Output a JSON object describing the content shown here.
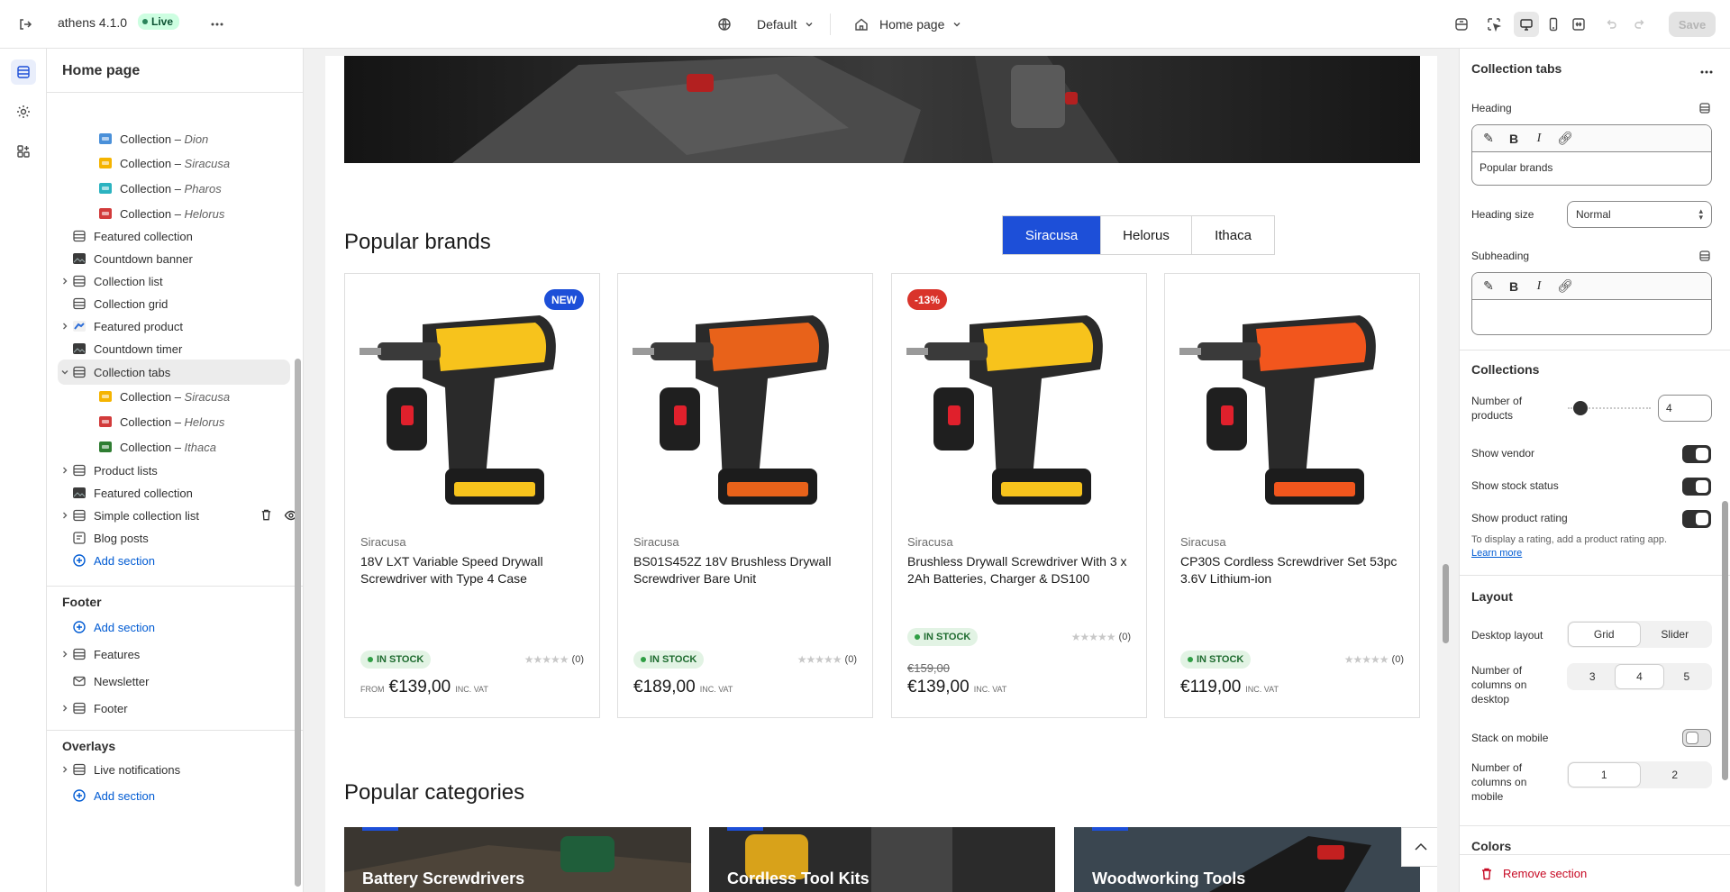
{
  "topbar": {
    "theme_name": "athens 4.1.0",
    "live_label": "Live",
    "theme_selector": "Default",
    "page_selector": "Home page",
    "save_label": "Save"
  },
  "left_panel": {
    "title": "Home page",
    "template_items": [
      {
        "label": "Collection – ",
        "sub": "Dion",
        "indent": 2,
        "icon": "collection-thumb-icon",
        "color": "#4a90d9"
      },
      {
        "label": "Collection – ",
        "sub": "Siracusa",
        "indent": 2,
        "icon": "collection-thumb-icon",
        "color": "#f5b400"
      },
      {
        "label": "Collection – ",
        "sub": "Pharos",
        "indent": 2,
        "icon": "collection-thumb-icon",
        "color": "#2bb3c0"
      },
      {
        "label": "Collection – ",
        "sub": "Helorus",
        "indent": 2,
        "icon": "collection-thumb-icon",
        "color": "#d23b3b"
      },
      {
        "label": "Featured collection",
        "sub": "",
        "indent": 1,
        "icon": "section-icon"
      },
      {
        "label": "Countdown banner",
        "sub": "",
        "indent": 1,
        "icon": "image-thumb-icon"
      },
      {
        "label": "Collection list",
        "sub": "",
        "indent": 1,
        "icon": "section-icon",
        "chevron": "right"
      },
      {
        "label": "Collection grid",
        "sub": "",
        "indent": 1,
        "icon": "section-icon"
      },
      {
        "label": "Featured product",
        "sub": "",
        "indent": 1,
        "icon": "product-thumb-icon",
        "chevron": "right"
      },
      {
        "label": "Countdown timer",
        "sub": "",
        "indent": 1,
        "icon": "image-thumb-icon"
      },
      {
        "label": "Collection tabs",
        "sub": "",
        "indent": 1,
        "icon": "section-icon",
        "chevron": "down",
        "selected": true
      },
      {
        "label": "Collection – ",
        "sub": "Siracusa",
        "indent": 2,
        "icon": "collection-thumb-icon",
        "color": "#f5b400"
      },
      {
        "label": "Collection – ",
        "sub": "Helorus",
        "indent": 2,
        "icon": "collection-thumb-icon",
        "color": "#d23b3b"
      },
      {
        "label": "Collection – ",
        "sub": "Ithaca",
        "indent": 2,
        "icon": "collection-thumb-icon",
        "color": "#2f7d32"
      },
      {
        "label": "Product lists",
        "sub": "",
        "indent": 1,
        "icon": "section-icon",
        "chevron": "right"
      },
      {
        "label": "Featured collection",
        "sub": "",
        "indent": 1,
        "icon": "image-thumb-icon"
      },
      {
        "label": "Simple collection list",
        "sub": "",
        "indent": 1,
        "icon": "section-icon",
        "chevron": "right",
        "hover": true
      },
      {
        "label": "Blog posts",
        "sub": "",
        "indent": 1,
        "icon": "blog-icon"
      }
    ],
    "add_section": "Add section",
    "footer_heading": "Footer",
    "footer_items": [
      {
        "label": "Features",
        "chevron": "right"
      },
      {
        "label": "Newsletter"
      },
      {
        "label": "Footer",
        "chevron": "right"
      }
    ],
    "overlays_heading": "Overlays",
    "overlay_items": [
      {
        "label": "Live notifications",
        "chevron": "right"
      }
    ]
  },
  "preview": {
    "popular_brands_title": "Popular brands",
    "tabs": [
      "Siracusa",
      "Helorus",
      "Ithaca"
    ],
    "active_tab": "Siracusa",
    "products": [
      {
        "vendor": "Siracusa",
        "name": "18V LXT Variable Speed Drywall Screwdriver with Type 4 Case",
        "badge": "NEW",
        "badge_color": "#1d4fd8",
        "stock": "IN STOCK",
        "rating_count": "(0)",
        "from": "FROM",
        "price": "€139,00",
        "old_price": "",
        "vat": "INC. VAT",
        "body_color": "#f7c31c"
      },
      {
        "vendor": "Siracusa",
        "name": "BS01S452Z 18V Brushless Drywall Screwdriver Bare Unit",
        "badge": "",
        "stock": "IN STOCK",
        "rating_count": "(0)",
        "from": "",
        "price": "€189,00",
        "old_price": "",
        "vat": "INC. VAT",
        "body_color": "#e8621a"
      },
      {
        "vendor": "Siracusa",
        "name": "Brushless Drywall Screwdriver With 3 x 2Ah Batteries, Charger & DS100",
        "badge": "-13%",
        "badge_color": "#d9342b",
        "stock": "IN STOCK",
        "rating_count": "(0)",
        "from": "",
        "price": "€139,00",
        "old_price": "€159,00",
        "vat": "INC. VAT",
        "body_color": "#f7c31c"
      },
      {
        "vendor": "Siracusa",
        "name": "CP30S Cordless Screwdriver Set 53pc 3.6V Lithium-ion",
        "badge": "",
        "stock": "IN STOCK",
        "rating_count": "(0)",
        "from": "",
        "price": "€119,00",
        "old_price": "",
        "vat": "INC. VAT",
        "body_color": "#f2561d"
      }
    ],
    "popular_categories_title": "Popular categories",
    "categories": [
      "Battery Screwdrivers",
      "Cordless Tool Kits",
      "Woodworking Tools"
    ]
  },
  "right_panel": {
    "title": "Collection tabs",
    "heading_label": "Heading",
    "heading_value": "Popular brands",
    "heading_size_label": "Heading size",
    "heading_size_value": "Normal",
    "subheading_label": "Subheading",
    "subheading_value": "",
    "collections_heading": "Collections",
    "num_products_label": "Number of products",
    "num_products_value": "4",
    "num_products_slider_fraction": 0.08,
    "show_vendor_label": "Show vendor",
    "show_vendor": true,
    "show_stock_label": "Show stock status",
    "show_stock": true,
    "show_rating_label": "Show product rating",
    "show_rating": true,
    "rating_help": "To display a rating, add a product rating app.",
    "learn_more": "Learn more",
    "layout_heading": "Layout",
    "desktop_layout_label": "Desktop layout",
    "desktop_layout_options": [
      "Grid",
      "Slider"
    ],
    "desktop_layout_selected": "Grid",
    "columns_desktop_label": "Number of columns on desktop",
    "columns_desktop_options": [
      "3",
      "4",
      "5"
    ],
    "columns_desktop_selected": "4",
    "stack_mobile_label": "Stack on mobile",
    "stack_mobile": false,
    "columns_mobile_label": "Number of columns on mobile",
    "columns_mobile_options": [
      "1",
      "2"
    ],
    "columns_mobile_selected": "1",
    "colors_heading": "Colors",
    "remove_label": "Remove section"
  }
}
